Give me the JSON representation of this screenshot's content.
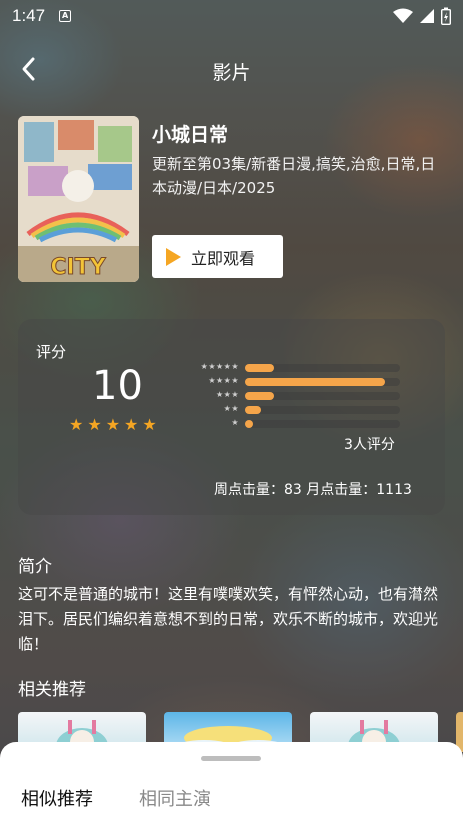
{
  "status_bar": {
    "time": "1:47",
    "sim_label": "A"
  },
  "header": {
    "title": "影片"
  },
  "movie": {
    "name": "小城日常",
    "meta": "更新至第03集/新番日漫,搞笑,治愈,日常,日本动漫/日本/2025",
    "poster_text": "CITY",
    "watch_label": "立即观看"
  },
  "rating": {
    "label": "评分",
    "score": "10",
    "star_rows": [
      {
        "stars": "★★★★★",
        "fraction": 0.19
      },
      {
        "stars": "★★★★",
        "fraction": 0.9
      },
      {
        "stars": "★★★",
        "fraction": 0.19
      },
      {
        "stars": "★★",
        "fraction": 0.1
      },
      {
        "stars": "★",
        "fraction": 0.05
      }
    ],
    "count_text": "3人评分",
    "clicks_text": "周点击量：83  月点击量：1113"
  },
  "intro": {
    "heading": "简介",
    "body": "这可不是普通的城市！这里有噗噗欢笑，有怦然心动，也有潸然泪下。居民们编织着意想不到的日常，欢乐不断的城市，欢迎光临！"
  },
  "recommend": {
    "heading": "相关推荐"
  },
  "sheet": {
    "tab_similar": "相似推荐",
    "tab_same_cast": "相同主演"
  },
  "colors": {
    "accent": "#f5a623",
    "bar": "#f5a54a"
  }
}
